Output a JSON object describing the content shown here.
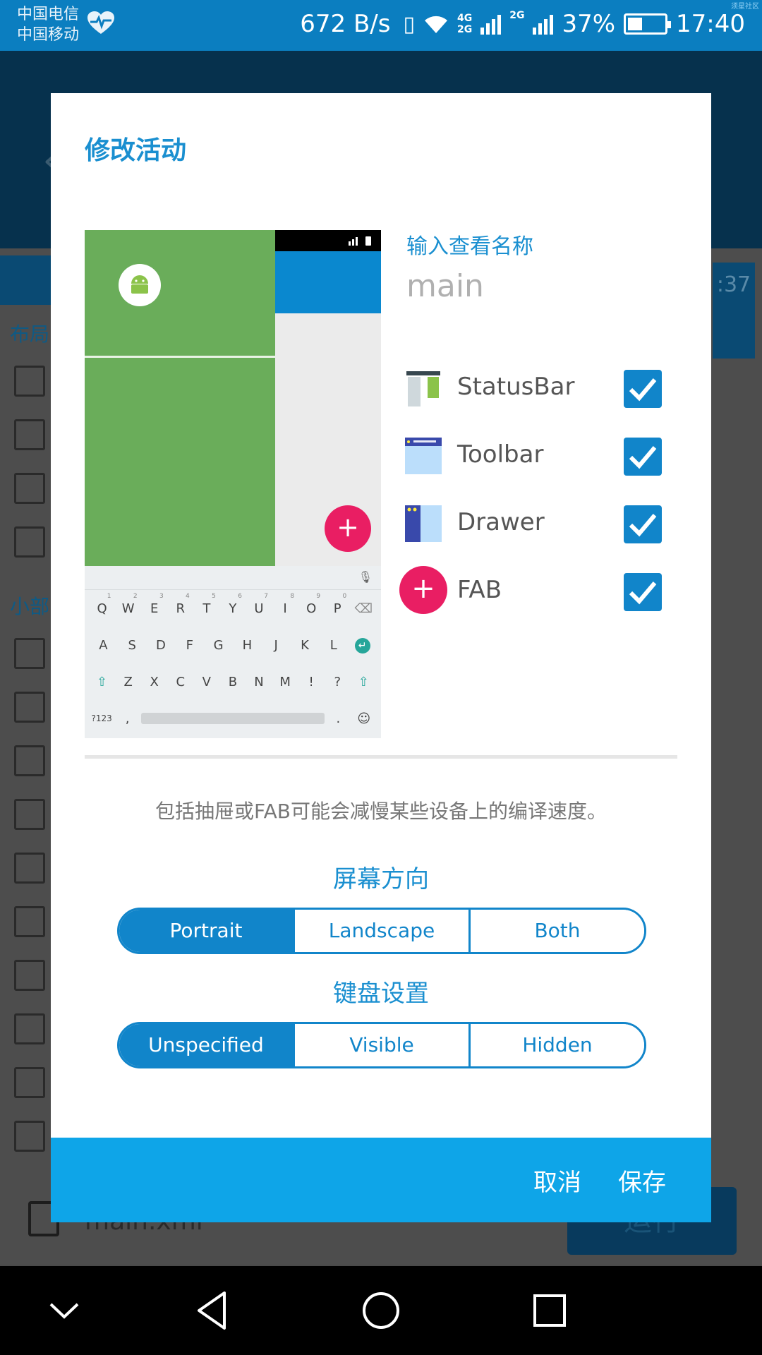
{
  "status_bar": {
    "carrier1": "中国电信",
    "carrier2": "中国移动",
    "speed": "672 B/s",
    "net1": "4G",
    "net1b": "2G",
    "net2": "2G",
    "battery": "37%",
    "time": "17:40",
    "watermark": "须星社区"
  },
  "background": {
    "tab_time": ":37",
    "label_layout": "布局",
    "label_widget": "小部",
    "file": "main.xml",
    "run_button": "运行"
  },
  "dialog": {
    "title": "修改活动",
    "name_label": "输入查看名称",
    "name_value": "",
    "name_placeholder": "main",
    "options": [
      {
        "label": "StatusBar",
        "checked": true,
        "icon": "statusbar-icon"
      },
      {
        "label": "Toolbar",
        "checked": true,
        "icon": "toolbar-icon"
      },
      {
        "label": "Drawer",
        "checked": true,
        "icon": "drawer-icon"
      },
      {
        "label": "FAB",
        "checked": true,
        "icon": "fab-icon"
      }
    ],
    "warning": "包括抽屉或FAB可能会减慢某些设备上的编译速度。",
    "orientation": {
      "title": "屏幕方向",
      "options": [
        "Portrait",
        "Landscape",
        "Both"
      ],
      "selected": "Portrait"
    },
    "keyboard": {
      "title": "键盘设置",
      "options": [
        "Unspecified",
        "Visible",
        "Hidden"
      ],
      "selected": "Unspecified"
    },
    "cancel": "取消",
    "save": "保存",
    "preview_keyboard": {
      "row1": [
        "Q",
        "W",
        "E",
        "R",
        "T",
        "Y",
        "U",
        "I",
        "O",
        "P"
      ],
      "row1_nums": [
        "1",
        "2",
        "3",
        "4",
        "5",
        "6",
        "7",
        "8",
        "9",
        "0"
      ],
      "row2": [
        "A",
        "S",
        "D",
        "F",
        "G",
        "H",
        "J",
        "K",
        "L"
      ],
      "row3": [
        "Z",
        "X",
        "C",
        "V",
        "B",
        "N",
        "M",
        "!",
        "?"
      ],
      "sym": "?123",
      "comma": ",",
      "period": ".",
      "emoji": "☺",
      "plus": "+"
    }
  },
  "colors": {
    "accent": "#1a8fd0",
    "checkbox": "#1185ca",
    "footer": "#0ea5e8",
    "fab": "#e91e63",
    "drawer_green": "#6aad5a"
  }
}
